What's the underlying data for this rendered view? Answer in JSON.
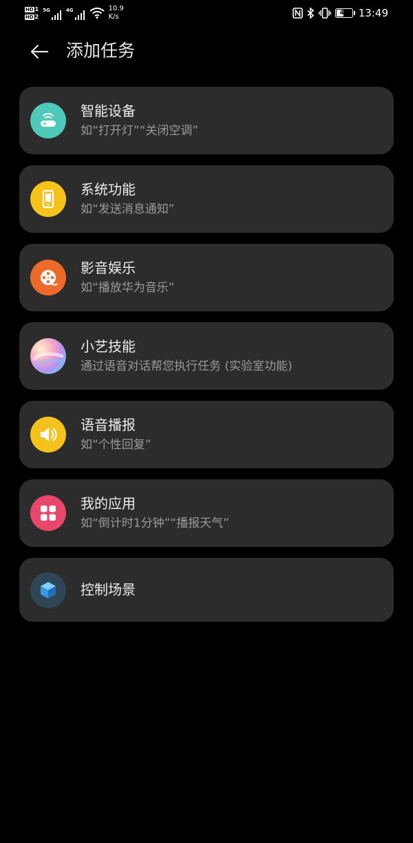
{
  "status_bar": {
    "sim1": "HD",
    "sim1_num": "1",
    "sim2": "HD",
    "sim2_num": "2",
    "net1": "5G",
    "net2": "4G",
    "speed_value": "10.9",
    "speed_unit": "K/s",
    "battery": "44",
    "battery_fraction": 0.44,
    "time": "13:49"
  },
  "header": {
    "title": "添加任务"
  },
  "items": [
    {
      "title": "智能设备",
      "subtitle": "如“打开灯”“关闭空调”",
      "icon": "router-icon",
      "color": "#4fc9b9"
    },
    {
      "title": "系统功能",
      "subtitle": "如“发送消息通知”",
      "icon": "phone-icon",
      "color": "#f4c21a"
    },
    {
      "title": "影音娱乐",
      "subtitle": "如“播放华为音乐”",
      "icon": "film-reel-icon",
      "color": "#ee6a2a"
    },
    {
      "title": "小艺技能",
      "subtitle": "通过语音对话帮您执行任务 (实验室功能)",
      "icon": "xiaoyi-orb-icon",
      "color": "#d99be0"
    },
    {
      "title": "语音播报",
      "subtitle": "如“个性回复”",
      "icon": "speaker-icon",
      "color": "#f4c21a"
    },
    {
      "title": "我的应用",
      "subtitle": "如“倒计时1分钟”“播报天气”",
      "icon": "app-grid-icon",
      "color": "#e8466a"
    },
    {
      "title": "控制场景",
      "subtitle": "",
      "icon": "cube-icon",
      "color": "#2f4656"
    }
  ]
}
